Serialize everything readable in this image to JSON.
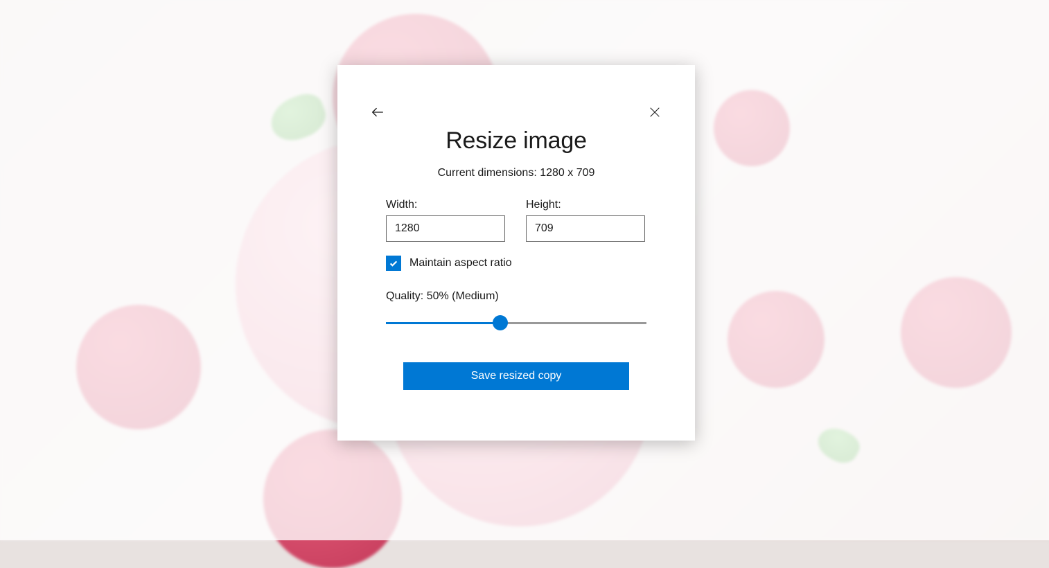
{
  "dialog": {
    "title": "Resize image",
    "current_dimensions_text": "Current dimensions: 1280 x 709",
    "width_label": "Width:",
    "width_value": "1280",
    "height_label": "Height:",
    "height_value": "709",
    "aspect_ratio_label": "Maintain aspect ratio",
    "aspect_ratio_checked": true,
    "quality_label": "Quality: 50% (Medium)",
    "quality_percent": 44,
    "save_button_label": "Save resized copy"
  },
  "colors": {
    "accent": "#0078d4"
  }
}
